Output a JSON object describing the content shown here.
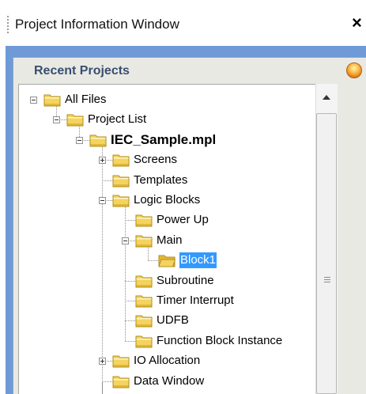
{
  "window": {
    "title": "Project Information Window",
    "close_glyph": "×"
  },
  "panel": {
    "title": "Recent Projects",
    "status_icon": "orange-orb-icon"
  },
  "tree": {
    "nodes": [
      {
        "label": "All Files",
        "level": 0,
        "expander": "minus"
      },
      {
        "label": "Project List",
        "level": 1,
        "expander": "minus"
      },
      {
        "label": "IEC_Sample.mpl",
        "level": 2,
        "expander": "minus",
        "bold": true
      },
      {
        "label": "Screens",
        "level": 3,
        "expander": "plus"
      },
      {
        "label": "Templates",
        "level": 3,
        "expander": "none"
      },
      {
        "label": "Logic Blocks",
        "level": 3,
        "expander": "minus"
      },
      {
        "label": "Power Up",
        "level": 4,
        "expander": "none"
      },
      {
        "label": "Main",
        "level": 4,
        "expander": "minus"
      },
      {
        "label": "Block1",
        "level": 5,
        "expander": "none",
        "selected": true,
        "open": true
      },
      {
        "label": "Subroutine",
        "level": 4,
        "expander": "none"
      },
      {
        "label": "Timer Interrupt",
        "level": 4,
        "expander": "none"
      },
      {
        "label": "UDFB",
        "level": 4,
        "expander": "none"
      },
      {
        "label": "Function Block Instance",
        "level": 4,
        "expander": "none"
      },
      {
        "label": "IO Allocation",
        "level": 3,
        "expander": "plus"
      },
      {
        "label": "Data Window",
        "level": 3,
        "expander": "none"
      },
      {
        "label": "",
        "level": 3,
        "expander": "none"
      }
    ]
  },
  "colors": {
    "frame": "#6e9ad8",
    "panel_title": "#394e70",
    "selection": "#3399ff",
    "folder": "#f4d35e"
  }
}
